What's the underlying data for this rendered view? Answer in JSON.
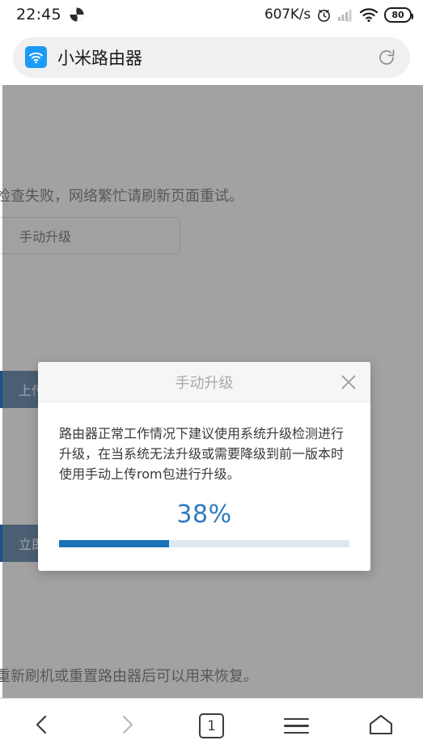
{
  "status_bar": {
    "time": "22:45",
    "sync_icon": "sync-icon",
    "network_speed": "607K/s",
    "alarm_icon": "alarm-clock-icon",
    "signal_icon": "cellular-signal-icon",
    "wifi_icon": "wifi-icon",
    "battery_level": "80"
  },
  "browser": {
    "favicon": "wifi-favicon",
    "page_title": "小米路由器",
    "reload_icon": "reload-icon"
  },
  "page": {
    "check_failed_text": "检查失败，网络繁忙请刷新页面重试。",
    "manual_upgrade_button": "手动升级",
    "upload_button": "上传",
    "restore_button": "立即恢复",
    "restore_hint_text": "重新刷机或重置路由器后可以用来恢复。"
  },
  "modal": {
    "title": "手动升级",
    "close_icon": "close-icon",
    "description": "路由器正常工作情况下建议使用系统升级检测进行升级，在当系统无法升级或需要降级到前一版本时使用手动上传rom包进行升级。",
    "percent_label": "38%",
    "progress_value": 38,
    "progress_fill_width": "38%",
    "accent_color": "#1b72b8",
    "percent_text_color": "#2f7bbf"
  },
  "navbar": {
    "back_icon": "chevron-left-icon",
    "forward_icon": "chevron-right-icon",
    "tab_count": "1",
    "menu_icon": "hamburger-menu-icon",
    "home_icon": "home-icon"
  }
}
